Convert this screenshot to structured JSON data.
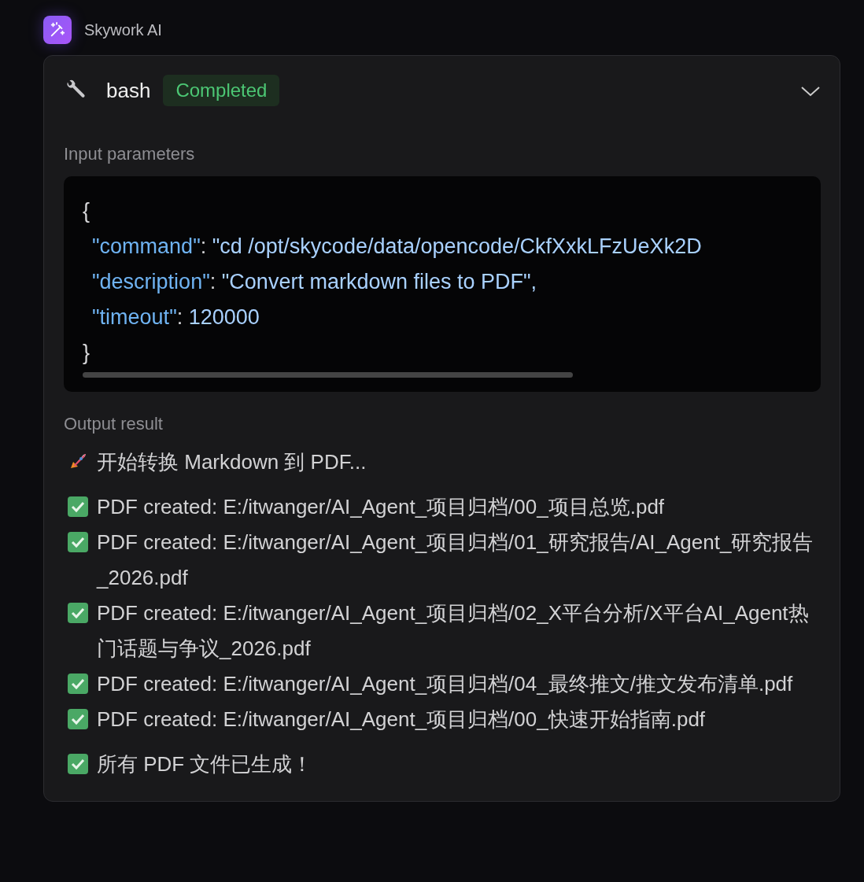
{
  "app": {
    "title": "Skywork AI"
  },
  "tool": {
    "name": "bash",
    "status": "Completed",
    "expanded": true
  },
  "input": {
    "label": "Input parameters",
    "lines": [
      {
        "kind": "brace",
        "text": "{"
      },
      {
        "kind": "pair",
        "key": "\"command\"",
        "separator": ": ",
        "value": "\"cd /opt/skycode/data/opencode/CkfXxkLFzUeXk2D"
      },
      {
        "kind": "pair",
        "key": "\"description\"",
        "separator": ": ",
        "value": "\"Convert markdown files to PDF\","
      },
      {
        "kind": "pair",
        "key": "\"timeout\"",
        "separator": ": ",
        "value": "120000"
      },
      {
        "kind": "brace",
        "text": "}"
      }
    ]
  },
  "output": {
    "label": "Output result",
    "lines": [
      {
        "kind": "rocket",
        "text": "开始转换 Markdown 到 PDF..."
      },
      {
        "kind": "check",
        "text": "PDF created: E:/itwanger/AI_Agent_项目归档/00_项目总览.pdf"
      },
      {
        "kind": "check",
        "text": "PDF created: E:/itwanger/AI_Agent_项目归档/01_研究报告/AI_Agent_研究报告_2026.pdf"
      },
      {
        "kind": "check",
        "text": "PDF created: E:/itwanger/AI_Agent_项目归档/02_X平台分析/X平台AI_Agent热门话题与争议_2026.pdf"
      },
      {
        "kind": "check",
        "text": "PDF created: E:/itwanger/AI_Agent_项目归档/04_最终推文/推文发布清单.pdf"
      },
      {
        "kind": "check",
        "text": "PDF created: E:/itwanger/AI_Agent_项目归档/00_快速开始指南.pdf"
      },
      {
        "kind": "check",
        "text": "所有 PDF 文件已生成！"
      }
    ]
  }
}
